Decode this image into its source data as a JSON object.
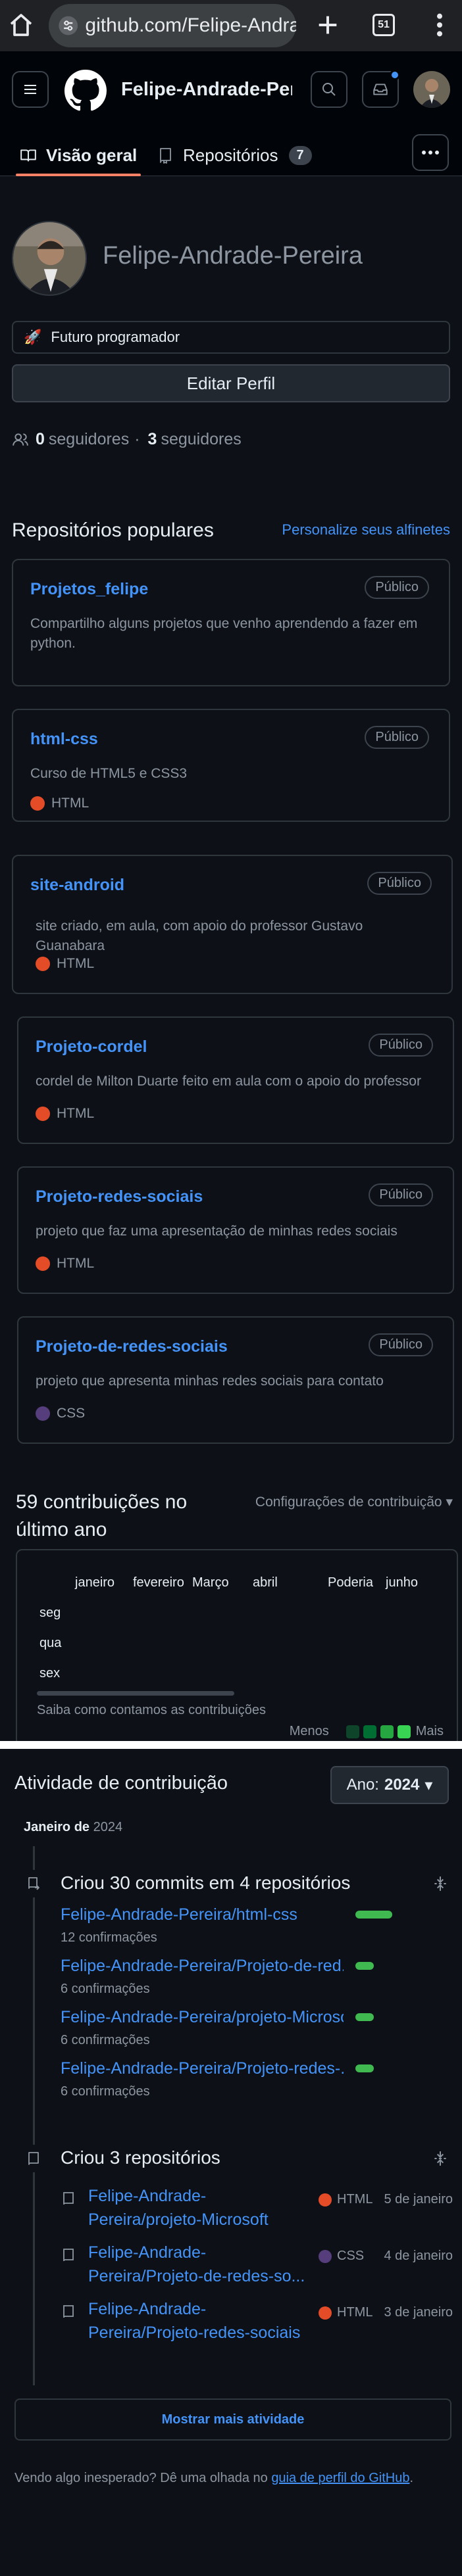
{
  "browser": {
    "url": "github.com/Felipe-Andra",
    "tab_count": "51"
  },
  "header": {
    "username": "Felipe-Andrade-Pere…",
    "tabs": [
      {
        "label": "Visão geral",
        "active": true
      },
      {
        "label": "Repositórios",
        "count": "7",
        "active": false
      }
    ]
  },
  "profile": {
    "name": "Felipe-Andrade-Pereira",
    "status_emoji": "🚀",
    "status": "Futuro programador",
    "edit_label": "Editar Perfil",
    "followers_count": "0",
    "followers_label": "seguidores",
    "separator": "·",
    "following_count": "3",
    "following_label": "seguidores"
  },
  "popular": {
    "title": "Repositórios populares",
    "customize": "Personalize seus alfinetes",
    "repos": [
      {
        "name": "Projetos_felipe",
        "visibility": "Público",
        "description": "Compartilho alguns projetos que venho aprendendo a fazer em python.",
        "language": ""
      },
      {
        "name": "html-css",
        "visibility": "Público",
        "description": "Curso de HTML5 e CSS3",
        "language": "HTML"
      },
      {
        "name": "site-android",
        "visibility": "Público",
        "description": "site criado, em aula, com apoio do professor Gustavo Guanabara",
        "language": "HTML"
      },
      {
        "name": "Projeto-cordel",
        "visibility": "Público",
        "description": "cordel de Milton Duarte feito em aula com o apoio do professor",
        "language": "HTML"
      },
      {
        "name": "Projeto-redes-sociais",
        "visibility": "Público",
        "description": "projeto que faz uma apresentação de minhas redes sociais",
        "language": "HTML"
      },
      {
        "name": "Projeto-de-redes-sociais",
        "visibility": "Público",
        "description": "projeto que apresenta minhas redes sociais para contato",
        "language": "CSS"
      }
    ]
  },
  "contributions": {
    "title": "59 contribuições no último ano",
    "settings": "Configurações de contribuição",
    "months": [
      "janeiro",
      "fevereiro",
      "Março",
      "abril",
      "Poderia",
      "junho"
    ],
    "days": [
      "seg",
      "qua",
      "sex"
    ],
    "learn": "Saiba como contamos as contribuições",
    "less": "Menos",
    "more": "Mais"
  },
  "activity": {
    "title": "Atividade de contribuição",
    "year_label": "Ano:",
    "year": "2024",
    "month": "Janeiro de",
    "month_year": "2024",
    "commits": {
      "heading": "Criou 30 commits em 4 repositórios",
      "items": [
        {
          "repo": "Felipe-Andrade-Pereira/html-css",
          "count": "12 confirmações",
          "share": 1.0
        },
        {
          "repo": "Felipe-Andrade-Pereira/Projeto-de-red...",
          "count": "6 confirmações",
          "share": 0.5
        },
        {
          "repo": "Felipe-Andrade-Pereira/projeto-Microsoft",
          "count": "6 confirmações",
          "share": 0.5
        },
        {
          "repo": "Felipe-Andrade-Pereira/Projeto-redes-...",
          "count": "6 confirmações",
          "share": 0.5
        }
      ]
    },
    "created": {
      "heading": "Criou 3 repositórios",
      "items": [
        {
          "repo": "Felipe-Andrade-Pereira/projeto-Microsoft",
          "language": "HTML",
          "date": "5 de janeiro"
        },
        {
          "repo": "Felipe-Andrade-Pereira/Projeto-de-redes-so...",
          "language": "CSS",
          "date": "4 de janeiro"
        },
        {
          "repo": "Felipe-Andrade-Pereira/Projeto-redes-sociais",
          "language": "HTML",
          "date": "3 de janeiro"
        }
      ]
    },
    "show_more": "Mostrar mais atividade",
    "footer_text": "Vendo algo inesperado? Dê uma olhada no",
    "footer_link": "guia de perfil do GitHub",
    "footer_end": "."
  },
  "colors": {
    "html": "#e34c26",
    "css": "#563d7c",
    "accent": "#4493f8",
    "tab_underline": "#f78166",
    "graph": [
      "#0e4429",
      "#006d32",
      "#26a641",
      "#39d353"
    ]
  }
}
